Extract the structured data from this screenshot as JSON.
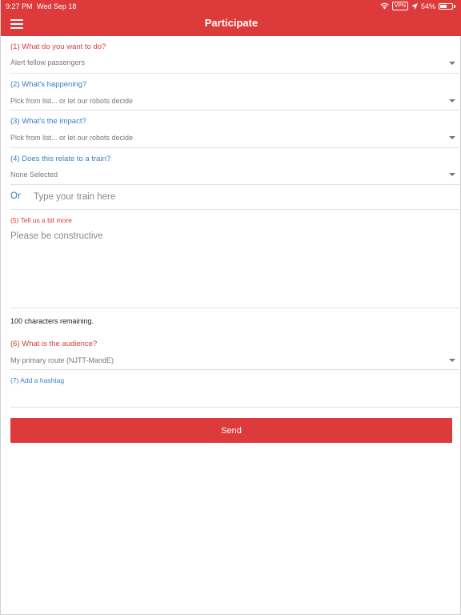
{
  "status_bar": {
    "time": "9:27 PM",
    "date": "Wed Sep 18",
    "vpn": "VPN",
    "battery": "54%",
    "battery_level": 0.54
  },
  "header": {
    "title": "Participate",
    "menu_icon": "hamburger-menu-icon"
  },
  "form": {
    "q1": {
      "label": "(1) What do you want to do?",
      "value": "Alert fellow passengers"
    },
    "q2": {
      "label": "(2) What's happening?",
      "value": "Pick from list... or let our robots decide"
    },
    "q3": {
      "label": "(3) What's the impact?",
      "value": "Pick from list... or let our robots decide"
    },
    "q4": {
      "label": "(4) Does this relate to a train?",
      "value": "None Selected"
    },
    "train": {
      "or_label": "Or",
      "placeholder": "Type your train here"
    },
    "q5": {
      "label": "(5) Tell us a bit more",
      "placeholder": "Please be constructive"
    },
    "remaining": "100 characters remaining.",
    "q6": {
      "label": "(6) What is the audience?",
      "value": "My primary route (NJTT-MandE)"
    },
    "q7": {
      "label": "(7) Add a hashtag"
    },
    "send_label": "Send"
  },
  "colors": {
    "brand_red": "#dd3b3b",
    "label_red": "#d0403a",
    "label_blue": "#3b7dc6"
  }
}
